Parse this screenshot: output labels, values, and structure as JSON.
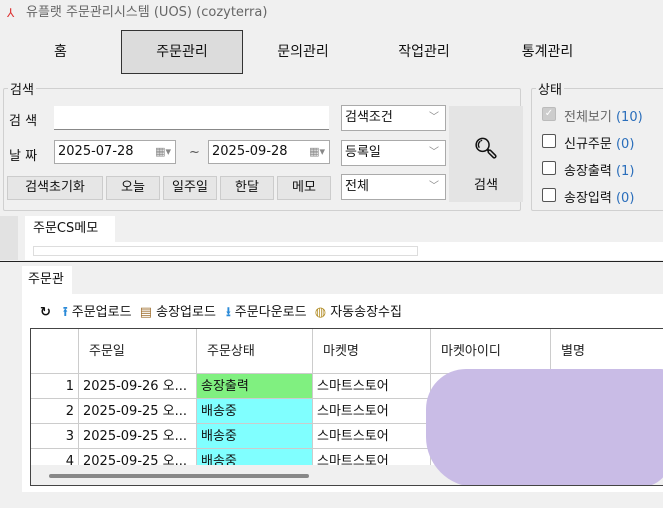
{
  "window": {
    "title": "유플랫 주문관리시스템 (UOS) (cozyterra)"
  },
  "nav": [
    "홈",
    "주문관리",
    "문의관리",
    "작업관리",
    "통계관리"
  ],
  "search": {
    "legend": "검색",
    "search_label": "검 색",
    "search_value": "",
    "date_label": "날 짜",
    "date_from": "2025-07-28",
    "date_to": "2025-09-28",
    "tilde": "~",
    "condition": "검색조건",
    "date_type": "등록일",
    "scope": "전체",
    "reset": "검색초기화",
    "today": "오늘",
    "week": "일주일",
    "month": "한달",
    "memo": "메모",
    "search_button": "검색"
  },
  "status": {
    "legend": "상태",
    "items": [
      {
        "label": "전체보기",
        "count": "(10)",
        "checked": true
      },
      {
        "label": "신규주문",
        "count": "(0)",
        "checked": false
      },
      {
        "label": "송장출력",
        "count": "(1)",
        "checked": false
      },
      {
        "label": "송장입력",
        "count": "(0)",
        "checked": false
      }
    ]
  },
  "cs_tab": "주문CS메모",
  "order_tab": "주문관리",
  "toolbar": {
    "upload": "주문업로드",
    "invoice_upload": "송장업로드",
    "download": "주문다운로드",
    "auto": "자동송장수집"
  },
  "table": {
    "columns": [
      "주문일",
      "주문상태",
      "마켓명",
      "마켓아이디",
      "별명"
    ],
    "rows": [
      {
        "no": "1",
        "date": "2025-09-26 오...",
        "status": "송장출력",
        "market": "스마트스토어",
        "color": "#80f080"
      },
      {
        "no": "2",
        "date": "2025-09-25 오...",
        "status": "배송중",
        "market": "스마트스토어",
        "color": "#80ffff"
      },
      {
        "no": "3",
        "date": "2025-09-25 오...",
        "status": "배송중",
        "market": "스마트스토어",
        "color": "#80ffff"
      },
      {
        "no": "4",
        "date": "2025-09-25 오...",
        "status": "배송중",
        "market": "스마트스토어",
        "color": "#80ffff"
      }
    ]
  }
}
